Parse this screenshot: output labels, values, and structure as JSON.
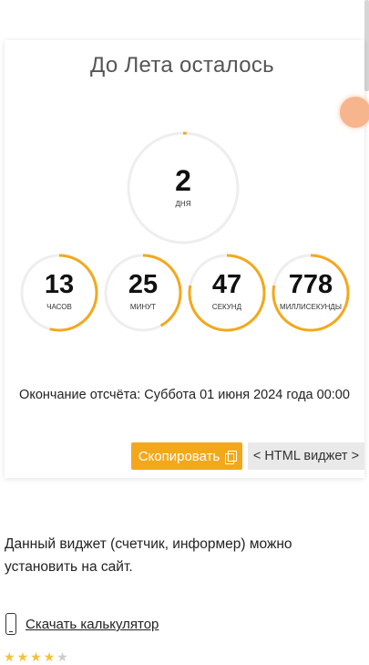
{
  "title": "До Лета осталось",
  "units": [
    {
      "id": "days",
      "value": "2",
      "label": "дня",
      "progress": 0.01
    },
    {
      "id": "hours",
      "value": "13",
      "label": "часов",
      "progress": 0.54
    },
    {
      "id": "minutes",
      "value": "25",
      "label": "минут",
      "progress": 0.42
    },
    {
      "id": "seconds",
      "value": "47",
      "label": "секунд",
      "progress": 0.78
    },
    {
      "id": "ms",
      "value": "778",
      "label": "миллисекунды",
      "progress": 0.78
    }
  ],
  "end_text": "Окончание отсчёта: Суббота 01 июня 2024 года 00:00",
  "buttons": {
    "copy": "Скопировать",
    "html_widget": "< HTML виджет >"
  },
  "description": "Данный виджет (счетчик, информер) можно установить на сайт.",
  "download_link": "Скачать калькулятор",
  "rating": {
    "filled": 4,
    "total": 5
  },
  "colors": {
    "accent": "#f3a81c",
    "track": "#eeeeee"
  },
  "icons": {
    "copy": "copy-icon",
    "phone": "phone-icon",
    "star": "star-icon"
  }
}
